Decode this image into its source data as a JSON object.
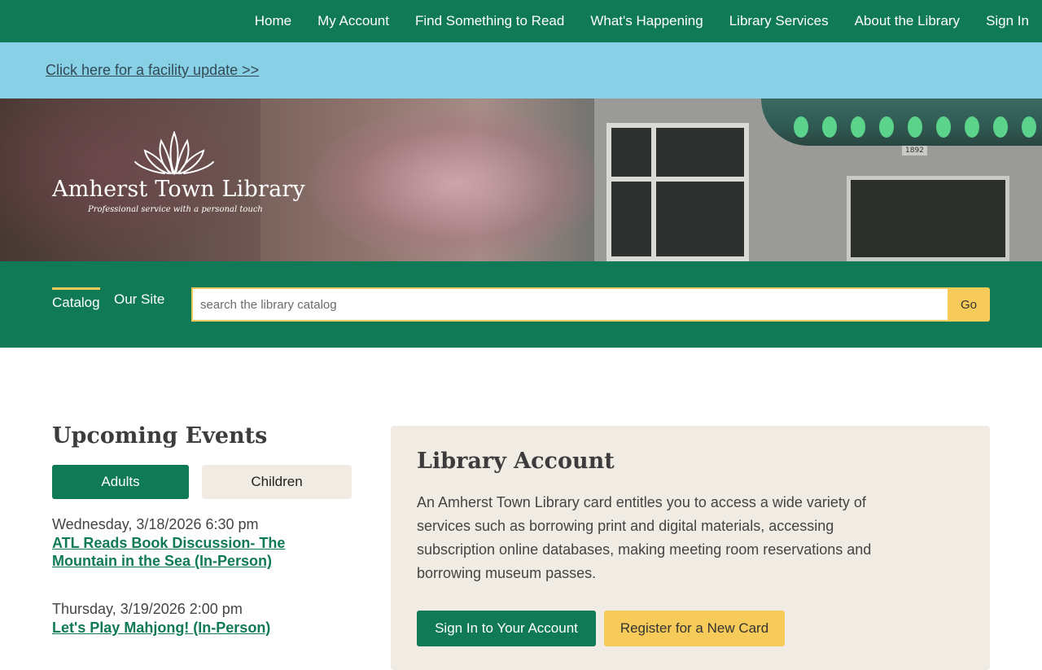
{
  "nav": {
    "items": [
      "Home",
      "My Account",
      "Find Something to Read",
      "What's Happening",
      "Library Services",
      "About the Library",
      "Sign In"
    ]
  },
  "alert": {
    "text": "Click here for a facility update >>"
  },
  "hero": {
    "library_name": "Amherst Town Library",
    "tagline": "Professional service with a personal touch",
    "building_number": "1892"
  },
  "search": {
    "tabs": [
      "Catalog",
      "Our Site"
    ],
    "active_tab": "Catalog",
    "placeholder": "search the library catalog",
    "value": "",
    "go_label": "Go"
  },
  "events": {
    "title": "Upcoming Events",
    "filters": [
      "Adults",
      "Children"
    ],
    "active_filter": "Adults",
    "items": [
      {
        "date": "Wednesday, 3/18/2026 6:30 pm",
        "title": "ATL Reads Book Discussion- The Mountain in the Sea (In-Person)"
      },
      {
        "date": "Thursday, 3/19/2026 2:00 pm",
        "title": "Let's Play Mahjong! (In-Person)"
      }
    ]
  },
  "account": {
    "title": "Library Account",
    "description": "An Amherst Town Library card entitles you to access a wide variety of services such as borrowing print and digital materials, accessing subscription online databases, making meeting room reservations and borrowing museum passes.",
    "signin_label": "Sign In to Your Account",
    "register_label": "Register for a New Card"
  },
  "colors": {
    "primary_green": "#0f7a55",
    "alert_blue": "#87d0e6",
    "accent_yellow": "#f7cb5a",
    "panel_beige": "#f0ebe3"
  }
}
